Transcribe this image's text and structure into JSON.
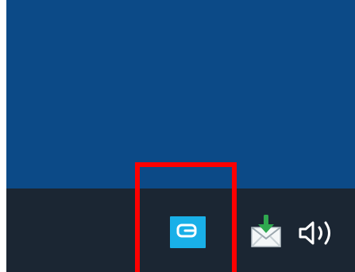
{
  "desktop": {
    "background_color": "#0c4a87"
  },
  "taskbar": {
    "background_color": "#1b2633",
    "tray_icons": [
      {
        "name": "app-tray-icon",
        "icon": "rounded-square-app-icon",
        "color": "#19b0e8"
      },
      {
        "name": "mail-download-icon",
        "icon": "envelope-with-green-down-arrow",
        "color": "#2fa84f"
      },
      {
        "name": "volume-icon",
        "icon": "speaker-icon",
        "color": "#ffffff"
      }
    ]
  },
  "highlight": {
    "color": "#ff0000",
    "target": "app-tray-icon"
  }
}
